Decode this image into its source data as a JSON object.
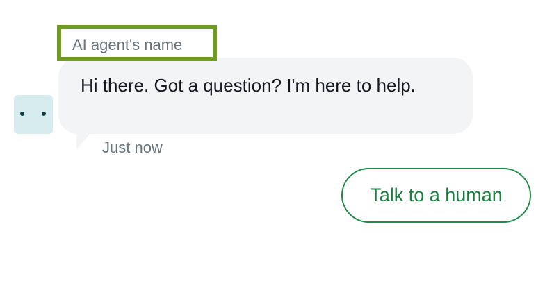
{
  "agent": {
    "name_label": "AI agent's name",
    "avatar_icon": "bot-face-icon"
  },
  "message": {
    "text": "Hi there. Got a question? I'm here to help.",
    "timestamp": "Just now"
  },
  "actions": {
    "talk_to_human_label": "Talk to a human"
  },
  "colors": {
    "highlight_border": "#6f9a25",
    "bubble_background": "#f3f4f6",
    "avatar_background": "#d6ecef",
    "accent_green": "#1f8a47",
    "muted_text": "#68737d"
  }
}
